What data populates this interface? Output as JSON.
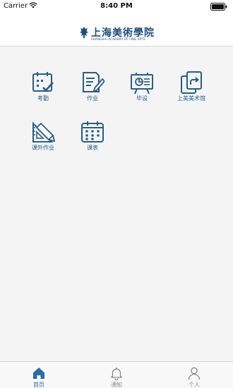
{
  "status_bar": {
    "carrier": "Carrier",
    "time": "8:40 PM"
  },
  "header": {
    "logo_title": "上海美術學院",
    "logo_subtitle": "SHANGHAI ACADEMY OF FINE ARTS"
  },
  "grid": {
    "items": [
      {
        "label": "考勤",
        "icon": "calendar-check-icon"
      },
      {
        "label": "作业",
        "icon": "document-edit-icon"
      },
      {
        "label": "毕设",
        "icon": "easel-icon"
      },
      {
        "label": "上美美术馆",
        "icon": "gallery-share-icon"
      },
      {
        "label": "课外作业",
        "icon": "ruler-pencil-icon"
      },
      {
        "label": "课表",
        "icon": "calendar-grid-icon"
      }
    ]
  },
  "tab_bar": {
    "active": "首页",
    "tabs": [
      {
        "label": "首页",
        "icon": "home-icon"
      },
      {
        "label": "通知",
        "icon": "bell-icon"
      },
      {
        "label": "个人",
        "icon": "person-icon"
      }
    ]
  },
  "colors": {
    "accent": "#2b6ca3",
    "icon": "#2a5d86",
    "background": "#f4f4f4"
  }
}
